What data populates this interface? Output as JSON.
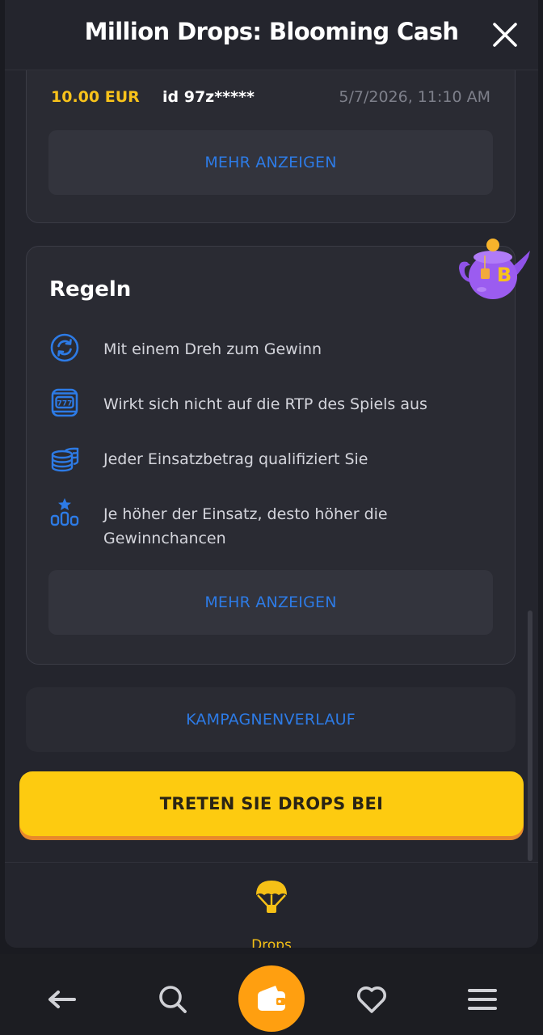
{
  "header": {
    "title": "Million Drops: Blooming Cash"
  },
  "winners": {
    "row": {
      "amount": "10.00 EUR",
      "user": "id 97z*****",
      "date": "5/7/2026, 11:10 AM"
    },
    "more_label": "MEHR ANZEIGEN"
  },
  "rules": {
    "title": "Regeln",
    "items": [
      {
        "icon": "refresh-icon",
        "text": "Mit einem Dreh zum Gewinn"
      },
      {
        "icon": "slot-machine-icon",
        "text": "Wirkt sich nicht auf die RTP des Spiels aus"
      },
      {
        "icon": "coins-icon",
        "text": "Jeder Einsatzbetrag qualifiziert Sie"
      },
      {
        "icon": "leaderboard-icon",
        "text": "Je höher der Einsatz, desto höher die Gewinnchancen"
      }
    ],
    "more_label": "MEHR ANZEIGEN"
  },
  "history_label": "KAMPAGNENVERLAUF",
  "join_label": "TRETEN SIE DROPS BEI",
  "tabbar": {
    "drops_label": "Drops"
  },
  "bottom_nav": [
    "back-arrow-icon",
    "search-icon",
    "wallet-icon",
    "heart-icon",
    "menu-icon"
  ],
  "colors": {
    "accent_yellow": "#fdcb10",
    "link_blue": "#2d7be6",
    "wallet_orange": "#ff9f10"
  }
}
